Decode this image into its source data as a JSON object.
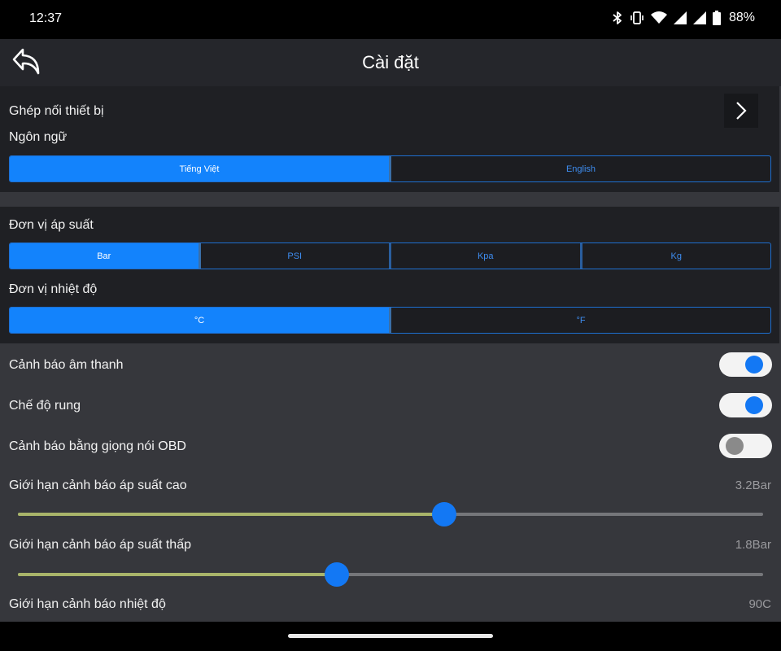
{
  "status_bar": {
    "time": "12:37",
    "battery": "88%",
    "icons": [
      "bluetooth-icon",
      "vibrate-icon",
      "wifi-icon",
      "signal-icon",
      "signal-icon",
      "battery-icon"
    ]
  },
  "header": {
    "title": "Cài đặt",
    "back_icon": "back-arrow-icon"
  },
  "device": {
    "pairing_label": "Ghép nối thiết bị",
    "chevron_icon": "chevron-right-icon"
  },
  "language": {
    "label": "Ngôn ngữ",
    "options": [
      "Tiếng Việt",
      "English"
    ],
    "selected": 0
  },
  "pressure_unit": {
    "label": "Đơn vị áp suất",
    "options": [
      "Bar",
      "PSI",
      "Kpa",
      "Kg"
    ],
    "selected": 0
  },
  "temperature_unit": {
    "label": "Đơn vị nhiệt độ",
    "options": [
      "°C",
      "°F"
    ],
    "selected": 0
  },
  "toggles": [
    {
      "label": "Cảnh báo âm thanh",
      "on": true
    },
    {
      "label": "Chế độ rung",
      "on": true
    },
    {
      "label": "Cảnh báo bằng giọng nói OBD",
      "on": false
    }
  ],
  "sliders": [
    {
      "label": "Giới hạn cảnh báo áp suất cao",
      "value": "3.2Bar",
      "fraction": 0.572
    },
    {
      "label": "Giới hạn cảnh báo áp suất thấp",
      "value": "1.8Bar",
      "fraction": 0.428
    },
    {
      "label": "Giới hạn cảnh báo nhiệt độ",
      "value": "90C"
    }
  ],
  "colors": {
    "accent": "#1383fc",
    "slider_fill": "#a9b46a",
    "card_bg": "#1f2024",
    "page_bg": "#36373c"
  }
}
